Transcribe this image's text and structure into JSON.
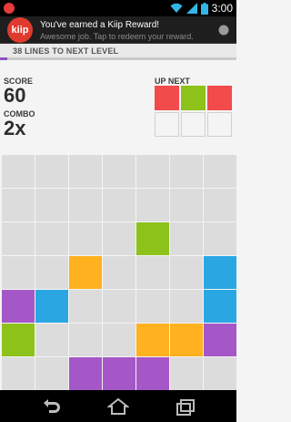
{
  "status_bar": {
    "time": "3:00",
    "icons": [
      "kiip-mini-icon",
      "wifi-icon",
      "signal-icon",
      "battery-icon"
    ]
  },
  "notification": {
    "logo_text": "kiip",
    "title": "You've earned a Kiip Reward!",
    "subtitle": "Awesome job. Tap to redeem your reward."
  },
  "level": {
    "text": "38 LINES TO NEXT LEVEL",
    "progress": 0.03
  },
  "score": {
    "label": "SCORE",
    "value": "60"
  },
  "combo": {
    "label": "COMBO",
    "value": "2x"
  },
  "up_next": {
    "label": "UP NEXT",
    "cells": [
      "#f24b4b",
      "#8cc21a",
      "#f24b4b",
      "",
      "",
      ""
    ]
  },
  "colors": {
    "empty": "#dcdcdc",
    "green": "#8cc21a",
    "orange": "#ffb11f",
    "blue": "#2aa7e3",
    "purple": "#a557c8",
    "red": "#f24b4b"
  },
  "board": [
    [
      "",
      "",
      "",
      "",
      "",
      "",
      ""
    ],
    [
      "",
      "",
      "",
      "",
      "",
      "",
      ""
    ],
    [
      "",
      "",
      "",
      "",
      "#8cc21a",
      "",
      ""
    ],
    [
      "",
      "",
      "#ffb11f",
      "",
      "",
      "",
      "#2aa7e3"
    ],
    [
      "#a557c8",
      "#2aa7e3",
      "",
      "",
      "",
      "",
      "#2aa7e3"
    ],
    [
      "#8cc21a",
      "",
      "",
      "",
      "#ffb11f",
      "#ffb11f",
      "#a557c8"
    ],
    [
      "",
      "",
      "#a557c8",
      "#a557c8",
      "#a557c8",
      "",
      ""
    ]
  ],
  "nav": {
    "buttons": [
      "back-icon",
      "home-icon",
      "recents-icon"
    ]
  }
}
